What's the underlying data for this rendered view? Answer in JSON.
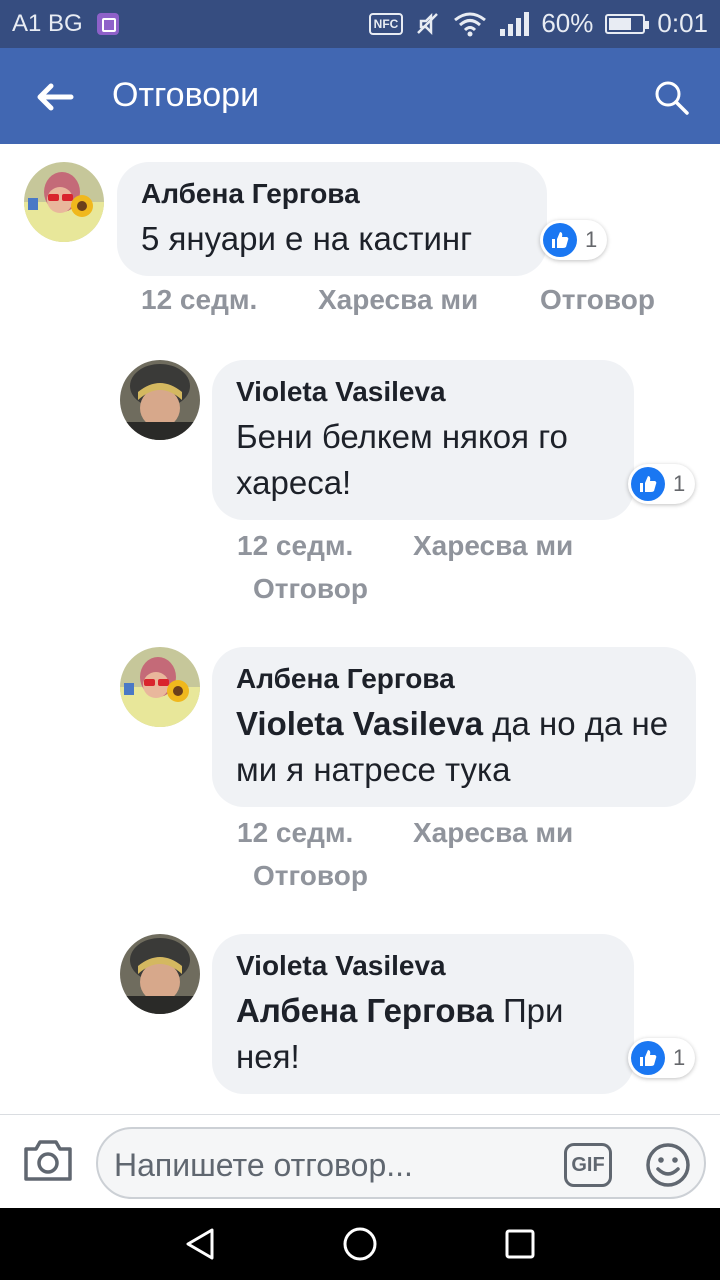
{
  "status_bar": {
    "carrier": "A1 BG",
    "nfc": "NFC",
    "battery": "60%",
    "time": "0:01"
  },
  "app_bar": {
    "title": "Отговори",
    "back_icon": "back-arrow-icon",
    "search_icon": "search-icon"
  },
  "comments": [
    {
      "author": "Албена Гергова",
      "mention": "",
      "text": "5 януари е на кастинг",
      "reactions": "1",
      "time": "12 седм.",
      "like": "Харесва ми",
      "reply": "Отговор"
    },
    {
      "author": "Violeta Vasileva",
      "mention": "",
      "text": "Бени белкем някоя го хареса!",
      "reactions": "1",
      "time": "12 седм.",
      "like": "Харесва ми",
      "reply": "Отговор"
    },
    {
      "author": "Албена Гергова",
      "mention": "Violeta Vasileva",
      "text": "да но да не ми я натресе тука",
      "time": "12 седм.",
      "like": "Харесва ми",
      "reply": "Отговор"
    },
    {
      "author": "Violeta Vasileva",
      "mention": "Албена Гергова",
      "text": "При нея!",
      "reactions": "1"
    }
  ],
  "composer": {
    "placeholder": "Напишете отговор...",
    "gif_label": "GIF"
  },
  "colors": {
    "app_bar": "#4167b2",
    "status_bar": "#364d80",
    "bubble": "#f0f2f5",
    "like_blue": "#1a77f2"
  }
}
